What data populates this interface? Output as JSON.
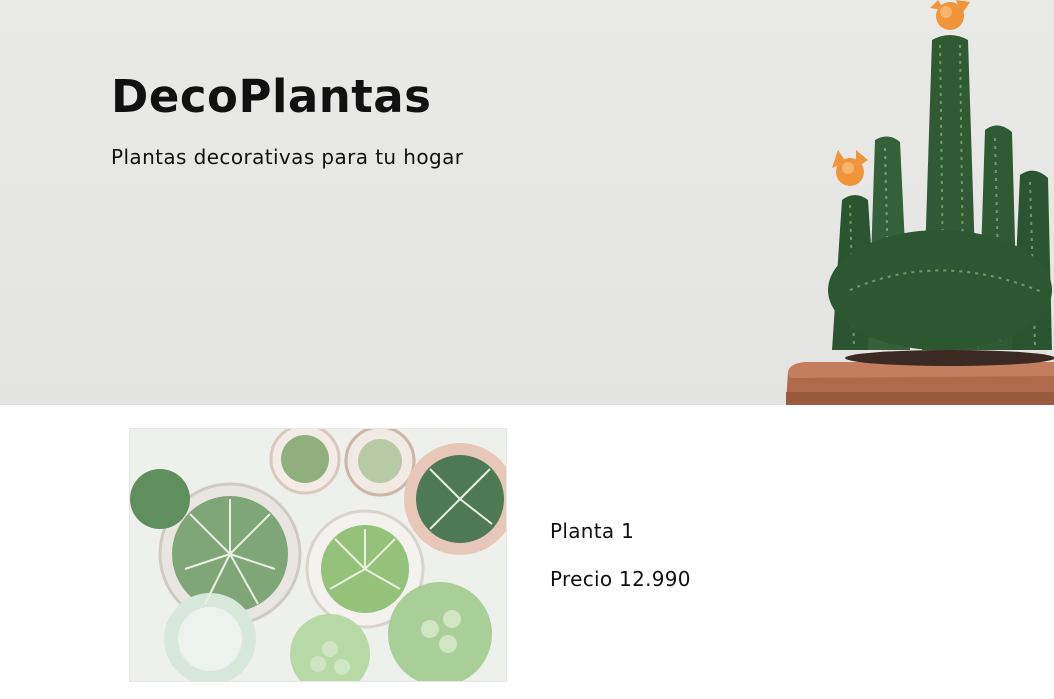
{
  "hero": {
    "title": "DecoPlantas",
    "subtitle": "Plantas decorativas para tu hogar",
    "background_color": "#e7e7e5",
    "image_icon": "cactus-in-pot-icon"
  },
  "products": [
    {
      "name": "Planta 1",
      "price": "Precio 12.990",
      "image_icon": "succulents-top-view-icon"
    }
  ],
  "colors": {
    "text": "#111111",
    "pot": "#b0694a",
    "cactus": "#2f5a33",
    "flower": "#f0953a",
    "succulent": "#8fbf7a"
  }
}
